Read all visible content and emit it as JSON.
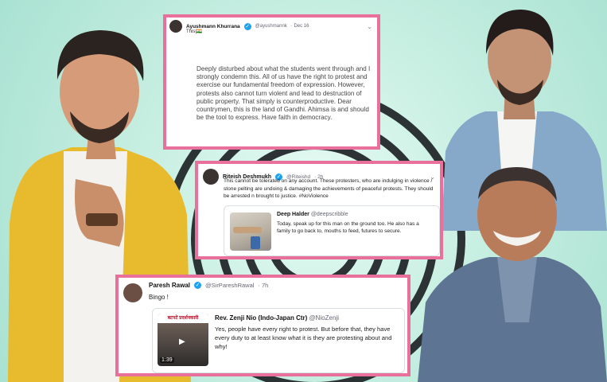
{
  "tweets": [
    {
      "name": "Ayushmann Khurrana",
      "handle": "@ayushmannk",
      "date": "· Dec 16",
      "sub": "This|🇮🇳",
      "text": "Deeply disturbed about what the students went through and I strongly condemn this. All of us have the right to protest and exercise our fundamental freedom of expression. However, protests also cannot turn violent and lead to destruction of public property. That simply is counterproductive. Dear countrymen, this is the land of Gandhi. Ahimsa is and should be the tool to express. Have faith in democracy."
    },
    {
      "name": "Riteish Deshmukh",
      "handle": "@Riteishd",
      "date": "· 2h",
      "text": "This cannot be tolerated on any account. These protesters, who are indulging in violence / stone pelting are undoing & damaging the achievements of peaceful protests. They should be arrested n brought to justice. #NoViolence",
      "quote_name": "Deep Halder",
      "quote_handle": "@deepscribble",
      "quote_text": "Today, speak up for this man on the ground too. He also has a family to go back to, mouths to feed, futures to secure."
    },
    {
      "name": "Paresh Rawal",
      "handle": "@SirPareshRawal",
      "date": "· 7h",
      "text": "Bingo !",
      "quote_name": "Rev. Zenji Nio (Indo-Japan Ctr)",
      "quote_handle": "@NioZenji",
      "quote_text": "Yes, people have every right to protest. But before that, they have every duty to at least know what it is they are protesting about and why!",
      "thumb_caption": "बटपटे प्रदर्शनकारी",
      "thumb_time": "1:39"
    }
  ],
  "colors": {
    "frame": "#e8709a",
    "background": "#bfeadd"
  },
  "icons": [
    "verified-badge-icon",
    "chevron-down-icon",
    "play-icon"
  ]
}
